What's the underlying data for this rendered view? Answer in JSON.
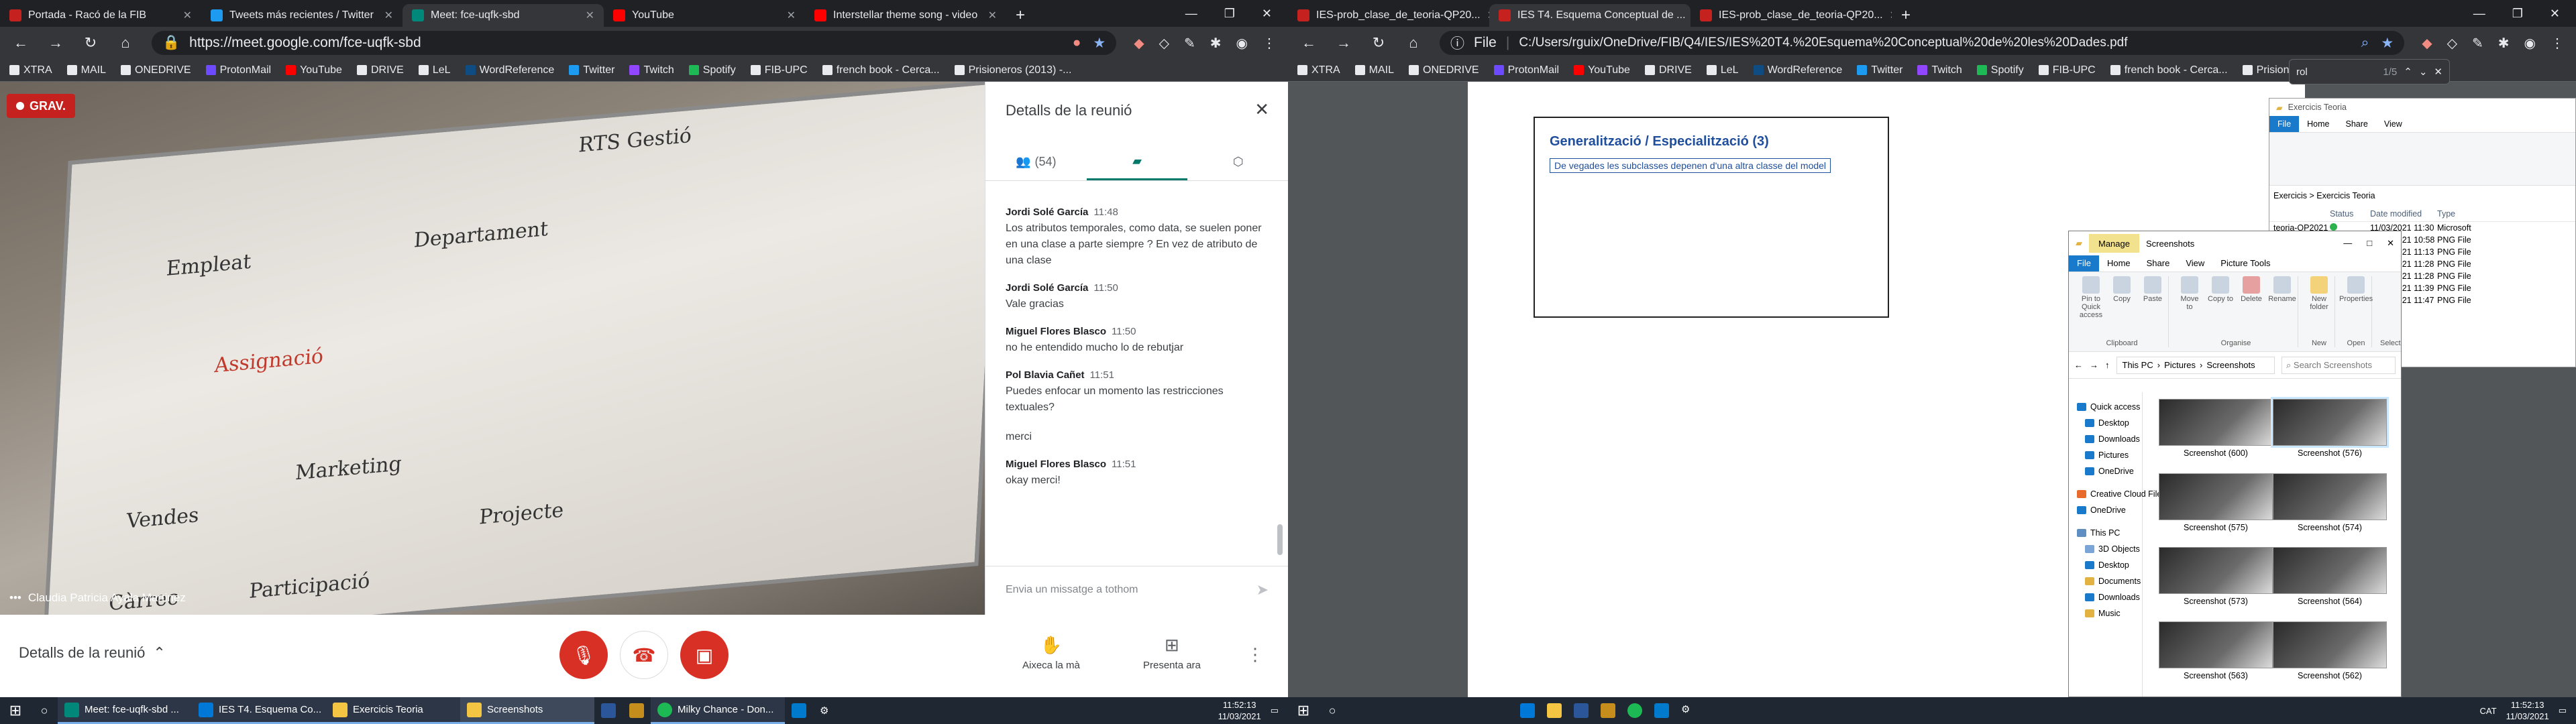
{
  "left_browser": {
    "tabs": [
      {
        "title": "Portada - Racó de la FIB",
        "color": "#c5221f"
      },
      {
        "title": "Tweets más recientes / Twitter",
        "color": "#1d9bf0"
      },
      {
        "title": "Meet: fce-uqfk-sbd",
        "color": "#00897b"
      },
      {
        "title": "YouTube",
        "color": "#ff0000"
      },
      {
        "title": "Interstellar theme song - video",
        "color": "#ff0000"
      }
    ],
    "new_tab": "+",
    "url": "https://meet.google.com/fce-uqfk-sbd",
    "bookmarks": [
      "XTRA",
      "MAIL",
      "ONEDRIVE",
      "ProtonMail",
      "YouTube",
      "DRIVE",
      "LeL",
      "WordReference",
      "Twitter",
      "Twitch",
      "Spotify",
      "FIB-UPC",
      "french book - Cerca...",
      "Prisioneros (2013) -..."
    ]
  },
  "meet": {
    "rec_label": "GRAV.",
    "participant_name": "Claudia Patricia Ayala Martinez",
    "board_lines": [
      "RTS Gestió",
      "Assignació",
      "Departament",
      "Empleat",
      "Marketing",
      "Vendes",
      "Projecte",
      "Participació",
      "Càrrec"
    ],
    "panel": {
      "title": "Detalls de la reunió",
      "people_count": "(54)",
      "messages": [
        {
          "who": "Jordi Solé García",
          "time": "11:48",
          "text": "Los atributos temporales, como data, se suelen poner en una clase a parte siempre ? En vez de atributo de una clase"
        },
        {
          "who": "Jordi Solé García",
          "time": "11:50",
          "text": "Vale gracias"
        },
        {
          "who": "Miguel Flores Blasco",
          "time": "11:50",
          "text": "no he entendido mucho lo de rebutjar"
        },
        {
          "who": "Pol Blavia Cañet",
          "time": "11:51",
          "text": "Puedes enfocar un momento las restricciones textuales?"
        },
        {
          "who": "",
          "time": "",
          "text": "merci"
        },
        {
          "who": "Miguel Flores Blasco",
          "time": "11:51",
          "text": "okay merci!"
        }
      ],
      "input_placeholder": "Envia un missatge a tothom"
    },
    "bottom": {
      "details_label": "Detalls de la reunió",
      "raise_hand": "Aixeca la mà",
      "present_now": "Presenta ara"
    }
  },
  "left_taskbar": {
    "items": [
      "Meet: fce-uqfk-sbd ...",
      "IES T4. Esquema Co...",
      "Exercicis Teoria",
      "Screenshots",
      "Milky Chance - Don..."
    ],
    "time": "11:52:13",
    "date": "11/03/2021"
  },
  "right_browser": {
    "tabs": [
      {
        "title": "IES-prob_clase_de_teoria-QP20...",
        "color": "#c5221f"
      },
      {
        "title": "IES T4. Esquema Conceptual de ...",
        "color": "#c5221f"
      },
      {
        "title": "IES-prob_clase_de_teoria-QP20...",
        "color": "#c5221f"
      }
    ],
    "url_prefix": "File",
    "url": "C:/Users/rguix/OneDrive/FIB/Q4/IES/IES%20T4.%20Esquema%20Conceptual%20de%20les%20Dades.pdf",
    "find_text": "rol",
    "find_count": "1/5",
    "pdf_heading": "Generalització / Especialització (3)",
    "pdf_sub": "De vegades les subclasses depenen d'una altra classe del model"
  },
  "explorer": {
    "title": "Screenshots",
    "manage": "Manage",
    "tabs": [
      "File",
      "Home",
      "Share",
      "View",
      "Picture Tools"
    ],
    "ribbon_groups": [
      "Clipboard",
      "Organise",
      "New",
      "Open",
      "Select"
    ],
    "ribbon_buttons": [
      "Pin to Quick access",
      "Copy",
      "Paste",
      "Move to",
      "Copy to",
      "Delete",
      "Rename",
      "New folder",
      "Properties"
    ],
    "path": [
      "This PC",
      "Pictures",
      "Screenshots"
    ],
    "search_placeholder": "Search Screenshots",
    "nav": [
      "Quick access",
      "Desktop",
      "Downloads",
      "Pictures",
      "OneDrive",
      "Creative Cloud Files",
      "OneDrive",
      "This PC",
      "3D Objects",
      "Desktop",
      "Documents",
      "Downloads",
      "Music"
    ],
    "thumbs": [
      "Screenshot (600)",
      "Screenshot (576)",
      "Screenshot (575)",
      "Screenshot (574)",
      "Screenshot (573)",
      "Screenshot (564)",
      "Screenshot (563)",
      "Screenshot (562)"
    ]
  },
  "explorer2": {
    "title": "Exercicis Teoria",
    "path": "Exercicis > Exercicis Teoria",
    "headers": [
      "Status",
      "Date modified",
      "Type"
    ],
    "rows": [
      {
        "name": "teoria-QP2021",
        "date": "11/03/2021 11:30",
        "type": "Microsoft"
      },
      {
        "name": "",
        "date": "11/03/2021 10:58",
        "type": "PNG File"
      },
      {
        "name": "",
        "date": "11/03/2021 11:13",
        "type": "PNG File"
      },
      {
        "name": "",
        "date": "11/03/2021 11:28",
        "type": "PNG File"
      },
      {
        "name": "",
        "date": "11/03/2021 11:28",
        "type": "PNG File"
      },
      {
        "name": "",
        "date": "11/03/2021 11:39",
        "type": "PNG File"
      },
      {
        "name": "",
        "date": "11/03/2021 11:47",
        "type": "PNG File"
      }
    ]
  },
  "right_taskbar": {
    "lang": "CAT",
    "time": "11:52:13",
    "date": "11/03/2021"
  }
}
